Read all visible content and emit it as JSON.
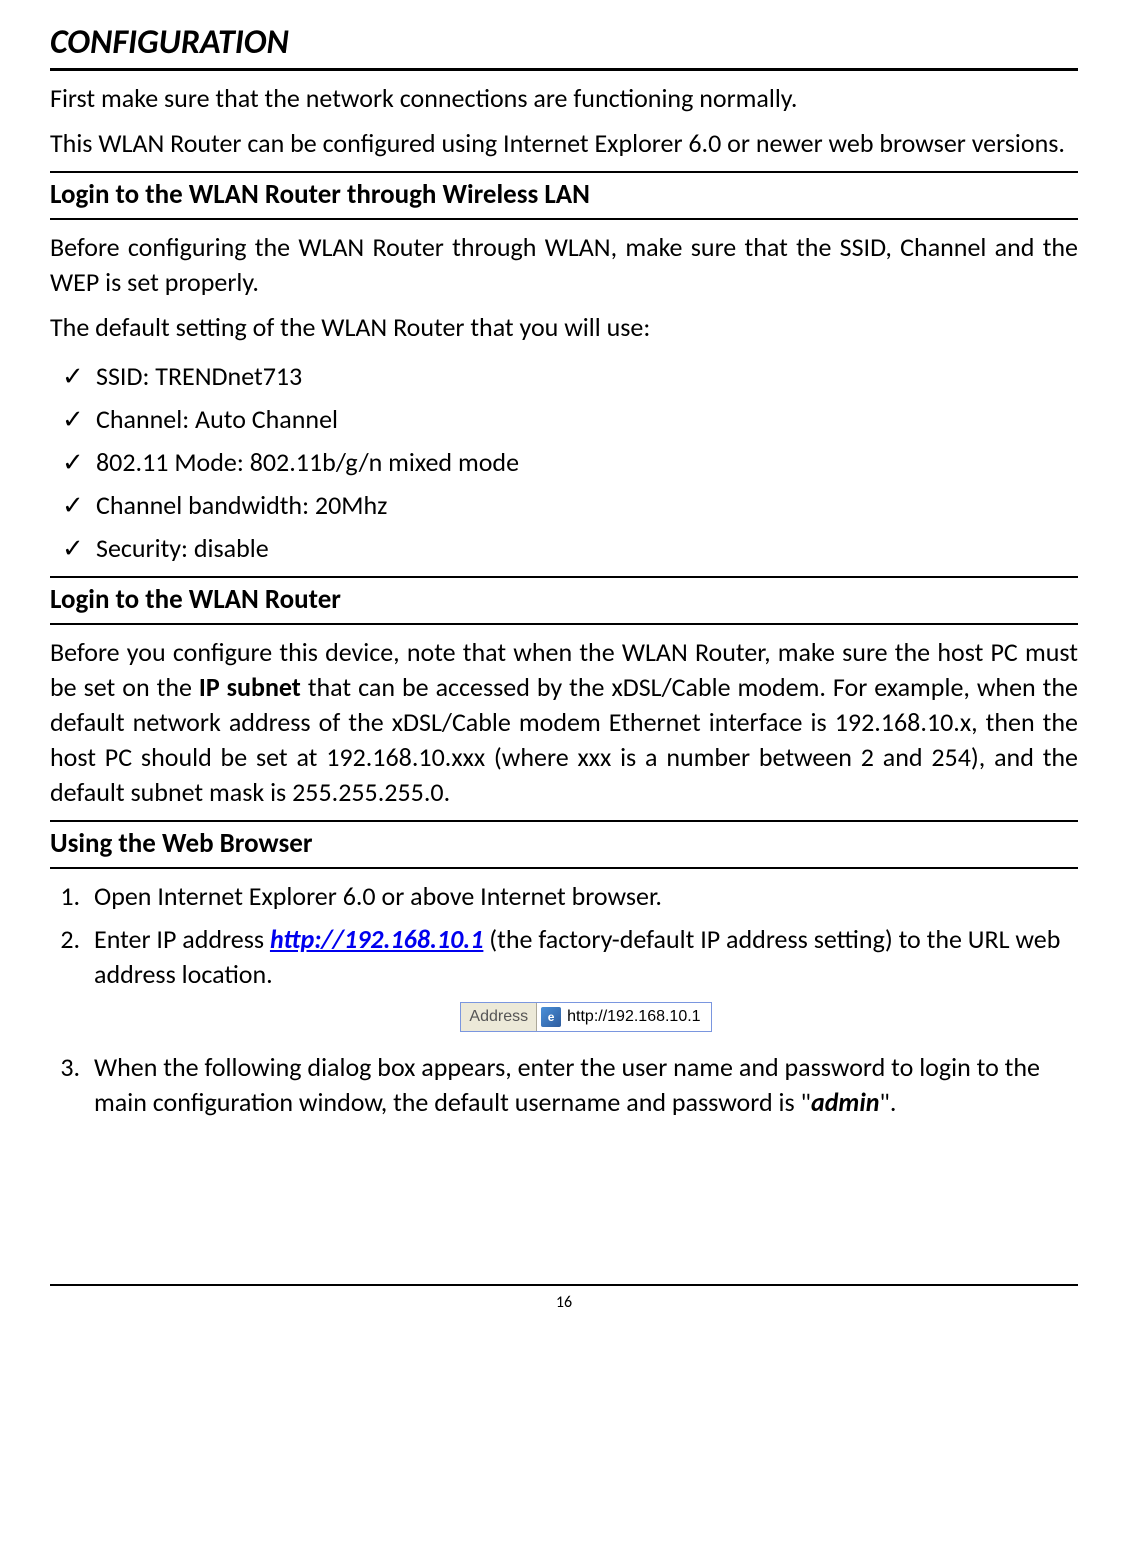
{
  "title": "CONFIGURATION",
  "intro": {
    "p1": "First make sure that the network connections are functioning normally.",
    "p2": "This WLAN Router can be configured using Internet Explorer 6.0 or newer web browser versions."
  },
  "section1": {
    "heading": "Login to the WLAN Router through Wireless LAN",
    "p1": "Before configuring the WLAN Router through WLAN, make sure that the SSID, Channel and the WEP is set properly.",
    "p2": "The default setting of the WLAN Router that you will use:",
    "items": [
      "SSID: TRENDnet713",
      "Channel: Auto Channel",
      "802.11 Mode: 802.11b/g/n mixed mode",
      "Channel bandwidth: 20Mhz",
      "Security: disable"
    ]
  },
  "section2": {
    "heading": "Login to the WLAN Router",
    "p1_pre": "Before you configure this device, note that when the WLAN Router, make sure the host PC must be set on the ",
    "p1_bold": "IP subnet",
    "p1_post": " that can be accessed by the xDSL/Cable modem. For example, when the default network address of the xDSL/Cable modem Ethernet interface is 192.168.10.x, then the host PC should be set at 192.168.10.xxx (where xxx is a number between 2 and 254), and the default subnet mask is 255.255.255.0."
  },
  "section3": {
    "heading": "Using the Web Browser",
    "step1": "Open Internet Explorer 6.0 or above Internet browser.",
    "step2_pre": "Enter IP address ",
    "step2_link": "http://192.168.10.1",
    "step2_post": " (the factory-default IP address setting) to the URL web address location.",
    "address_bar": {
      "label": "Address",
      "url": "http://192.168.10.1"
    },
    "step3_pre": "When the following dialog box appears, enter the user name and password to login to the main configuration window, the default username and password is \"",
    "step3_bold": "admin",
    "step3_post": "\"."
  },
  "page_number": "16"
}
